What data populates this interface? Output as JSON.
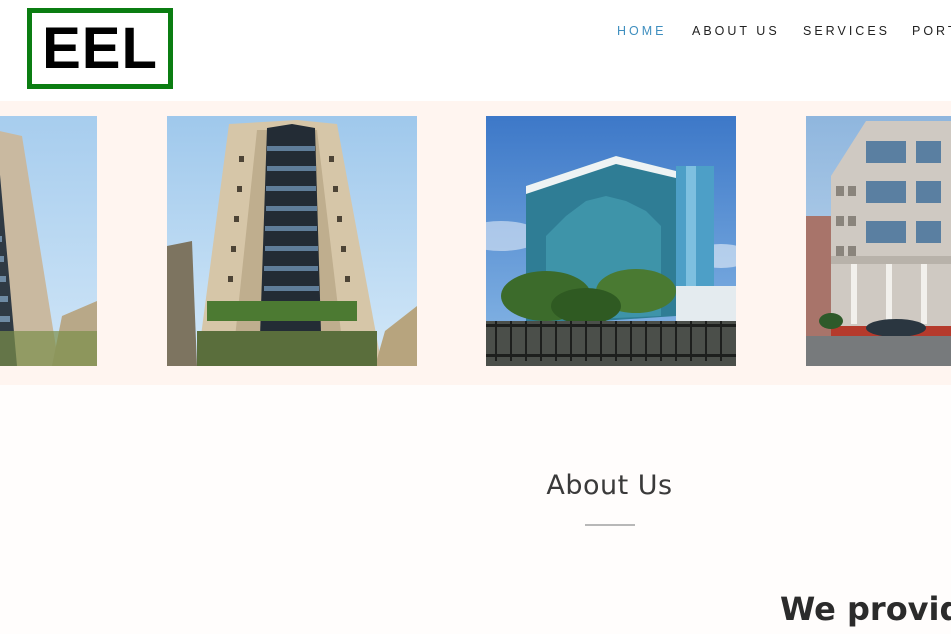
{
  "brand": {
    "logo_text": "EEL",
    "logo_border_color": "#0b7d12"
  },
  "nav": {
    "items": [
      {
        "label": "HOME",
        "active": true
      },
      {
        "label": "ABOUT US",
        "active": false
      },
      {
        "label": "SERVICES",
        "active": false
      },
      {
        "label": "PORT",
        "active": false
      }
    ],
    "active_color": "#3f8fbf"
  },
  "gallery": {
    "background": "#fff5f0",
    "photos": [
      {
        "subject": "tall-tower-building-partial"
      },
      {
        "subject": "tall-tower-building"
      },
      {
        "subject": "glass-office-building"
      },
      {
        "subject": "corner-office-building-partial"
      }
    ]
  },
  "about": {
    "title": "About Us",
    "headline": "We provide"
  }
}
